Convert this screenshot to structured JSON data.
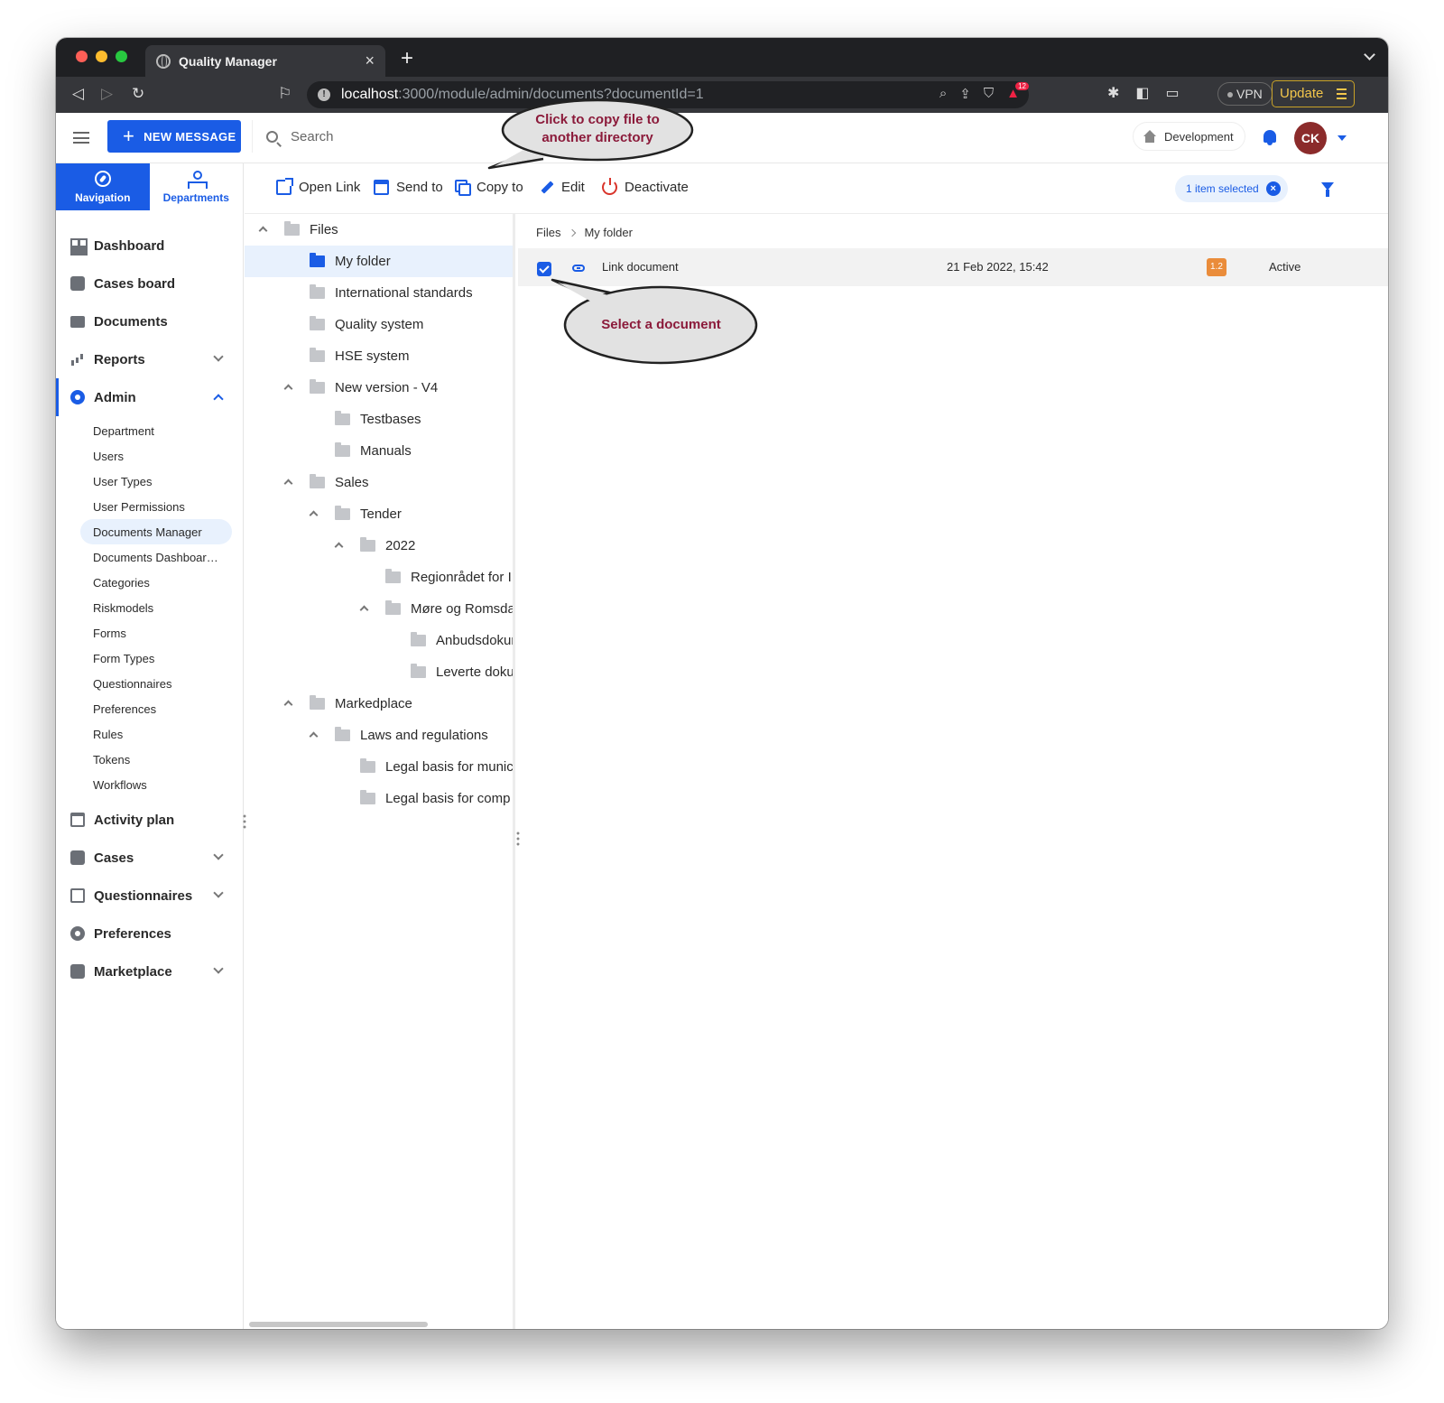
{
  "browser": {
    "tab_title": "Quality Manager",
    "new_tab": "+",
    "tab_close": "×",
    "url_host": "localhost",
    "url_path": ":3000/module/admin/documents?documentId=1",
    "vpn_label": "VPN",
    "update_label": "Update",
    "shields_count": "12"
  },
  "header": {
    "new_message_label": "NEW MESSAGE",
    "search_placeholder": "Search",
    "environment": "Development",
    "avatar_initials": "CK"
  },
  "sidebar": {
    "tabs": [
      {
        "label": "Navigation",
        "icon": "compass-icon",
        "active": true
      },
      {
        "label": "Departments",
        "icon": "org-chart-icon",
        "active": false
      }
    ],
    "items": [
      {
        "label": "Dashboard",
        "icon": "dashboard-icon"
      },
      {
        "label": "Cases board",
        "icon": "cases-board-icon"
      },
      {
        "label": "Documents",
        "icon": "folder-icon"
      },
      {
        "label": "Reports",
        "icon": "bar-chart-icon",
        "expandable": true
      },
      {
        "label": "Admin",
        "icon": "gear-icon",
        "expanded": true
      },
      {
        "label": "Activity plan",
        "icon": "calendar-icon"
      },
      {
        "label": "Cases",
        "icon": "cases-icon",
        "expandable": true
      },
      {
        "label": "Questionnaires",
        "icon": "clipboard-icon",
        "expandable": true
      },
      {
        "label": "Preferences",
        "icon": "gear-icon"
      },
      {
        "label": "Marketplace",
        "icon": "store-icon",
        "expandable": true
      }
    ],
    "admin_sub": [
      "Department",
      "Users",
      "User Types",
      "User Permissions",
      "Documents Manager",
      "Documents Dashboar…",
      "Categories",
      "Riskmodels",
      "Forms",
      "Form Types",
      "Questionnaires",
      "Preferences",
      "Rules",
      "Tokens",
      "Workflows"
    ],
    "admin_selected": "Documents Manager"
  },
  "actions": {
    "open_link": "Open Link",
    "send_to": "Send to",
    "copy_to": "Copy to",
    "edit": "Edit",
    "deactivate": "Deactivate",
    "selected_chip": "1 item selected"
  },
  "tree": [
    {
      "label": "Files",
      "depth": 0,
      "caret": true
    },
    {
      "label": "My folder",
      "depth": 1,
      "caret": false,
      "selected": true
    },
    {
      "label": "International standards",
      "depth": 1,
      "caret": false
    },
    {
      "label": "Quality system",
      "depth": 1,
      "caret": false
    },
    {
      "label": "HSE system",
      "depth": 1,
      "caret": false
    },
    {
      "label": "New version - V4",
      "depth": 1,
      "caret": true
    },
    {
      "label": "Testbases",
      "depth": 2,
      "caret": false
    },
    {
      "label": "Manuals",
      "depth": 2,
      "caret": false
    },
    {
      "label": "Sales",
      "depth": 1,
      "caret": true
    },
    {
      "label": "Tender",
      "depth": 2,
      "caret": true
    },
    {
      "label": "2022",
      "depth": 3,
      "caret": true
    },
    {
      "label": "Regionrådet for I",
      "depth": 4,
      "caret": false
    },
    {
      "label": "Møre og Romsda",
      "depth": 4,
      "caret": true
    },
    {
      "label": "Anbudsdokur",
      "depth": 5,
      "caret": false
    },
    {
      "label": "Leverte doku",
      "depth": 5,
      "caret": false
    },
    {
      "label": "Markedplace",
      "depth": 1,
      "caret": true
    },
    {
      "label": "Laws and regulations",
      "depth": 2,
      "caret": true
    },
    {
      "label": "Legal basis for munic",
      "depth": 3,
      "caret": false
    },
    {
      "label": "Legal basis for comp",
      "depth": 3,
      "caret": false
    }
  ],
  "breadcrumb": [
    "Files",
    "My folder"
  ],
  "documents": [
    {
      "name": "Link document",
      "date": "21 Feb 2022, 15:42",
      "version": "1.2",
      "status": "Active",
      "checked": true
    }
  ],
  "callouts": {
    "copy": "Click to copy file to another directory",
    "copy_line1": "Click to copy file to",
    "copy_line2": "another directory",
    "select": "Select a document"
  },
  "colors": {
    "accent": "#1a5ce5",
    "version_badge": "#ea8c3a",
    "avatar": "#8b2b2b",
    "callout_text": "#8b1a3a",
    "deactivate_icon": "#d9342b"
  }
}
